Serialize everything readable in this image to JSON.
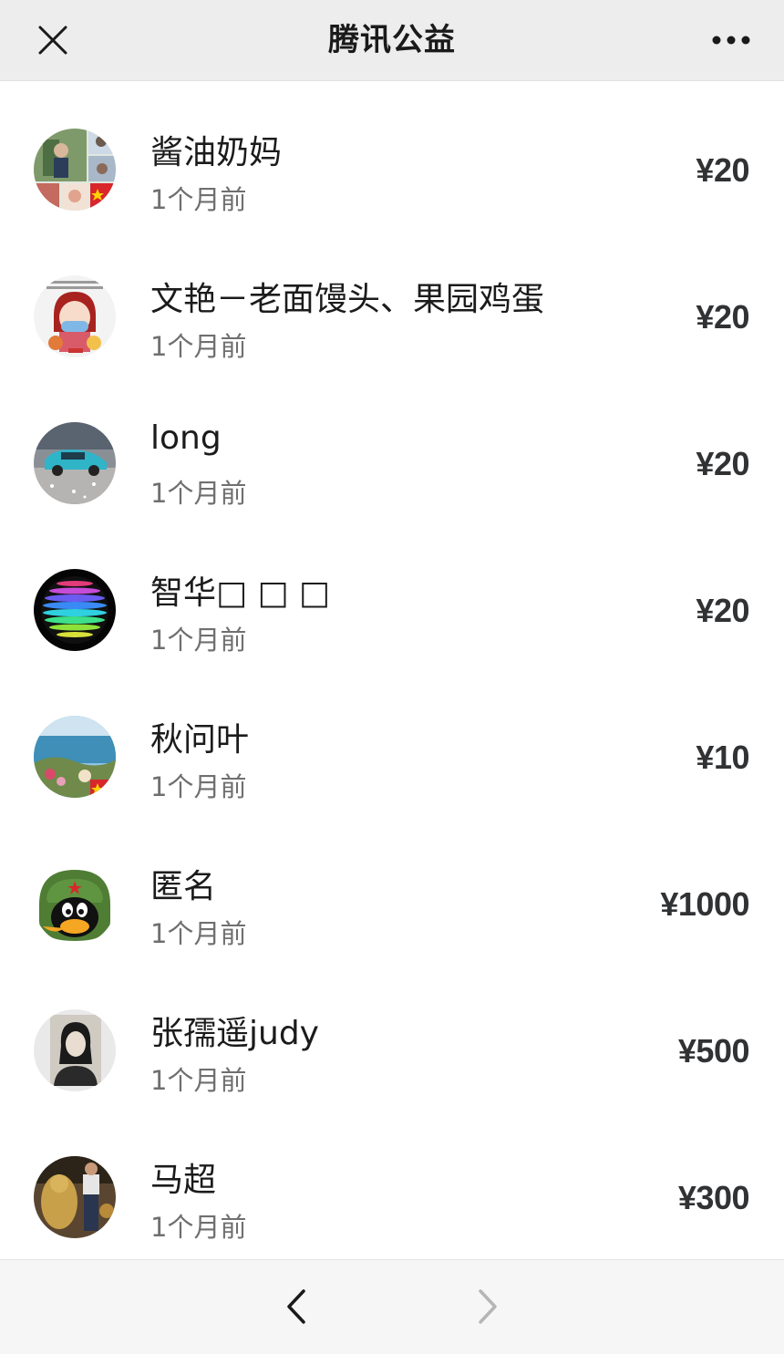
{
  "header": {
    "title": "腾讯公益"
  },
  "donations": [
    {
      "name": "酱油奶妈",
      "time": "1个月前",
      "amount": "¥20",
      "avatar": "photo-collage-avatar"
    },
    {
      "name": "文艳－老面馒头、果园鸡蛋",
      "time": "1个月前",
      "amount": "¥20",
      "avatar": "cartoon-girl-avatar"
    },
    {
      "name": "long",
      "time": "1个月前",
      "amount": "¥20",
      "avatar": "blue-car-avatar"
    },
    {
      "name": "智华□ □ □",
      "time": "1个月前",
      "amount": "¥20",
      "avatar": "rainbow-sphere-avatar"
    },
    {
      "name": "秋问叶",
      "time": "1个月前",
      "amount": "¥10",
      "avatar": "seaside-avatar"
    },
    {
      "name": "匿名",
      "time": "1个月前",
      "amount": "¥1000",
      "avatar": "qq-penguin-avatar"
    },
    {
      "name": "张孺遥judy",
      "time": "1个月前",
      "amount": "¥500",
      "avatar": "portrait-photo-avatar"
    },
    {
      "name": "马超",
      "time": "1个月前",
      "amount": "¥300",
      "avatar": "statue-photo-avatar"
    }
  ],
  "colors": {
    "header_bg": "#ededed",
    "text_primary": "#1b1b1b",
    "text_secondary": "#6f6f6f",
    "footer_bg": "#f6f6f6"
  },
  "icons": {
    "close": "close-icon",
    "more": "more-dots-icon",
    "prev": "chevron-left-icon",
    "next": "chevron-right-icon"
  }
}
